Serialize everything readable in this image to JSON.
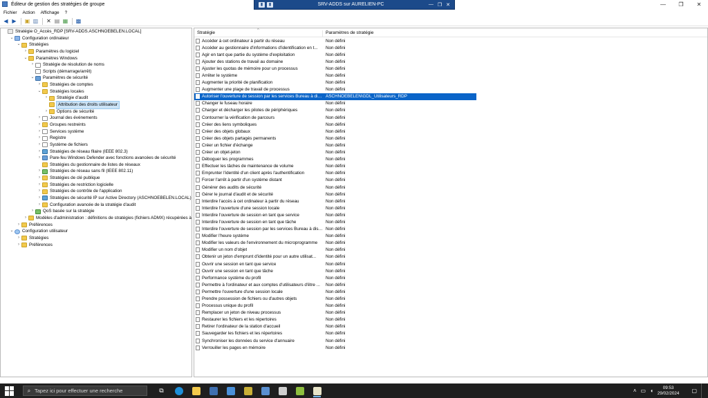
{
  "window": {
    "title": "Éditeur de gestion des stratégies de groupe",
    "controls": {
      "minimize": "—",
      "maximize": "❐",
      "close": "✕"
    }
  },
  "remote_bar": {
    "title": "SRV-ADDS sur AURELIEN-PC",
    "controls": {
      "minimize": "—",
      "restore": "❐",
      "close": "✕"
    }
  },
  "menu": {
    "items": [
      "Fichier",
      "Action",
      "Affichage",
      "?"
    ]
  },
  "tree": {
    "rows": [
      {
        "label": "Stratégie O_Accès_RDP [SRV-ADDS.ASCHNOEBELEN.LOCAL]",
        "indent": 0,
        "exp": "",
        "icon": "policy"
      },
      {
        "label": "Configuration ordinateur",
        "indent": 1,
        "exp": "⌄",
        "icon": "pc"
      },
      {
        "label": "Stratégies",
        "indent": 2,
        "exp": "⌄",
        "icon": "folder"
      },
      {
        "label": "Paramètres du logiciel",
        "indent": 3,
        "exp": "›",
        "icon": "folder"
      },
      {
        "label": "Paramètres Windows",
        "indent": 3,
        "exp": "⌄",
        "icon": "folder"
      },
      {
        "label": "Stratégie de résolution de noms",
        "indent": 4,
        "exp": "›",
        "icon": "doc"
      },
      {
        "label": "Scripts (démarrage/arrêt)",
        "indent": 4,
        "exp": "",
        "icon": "doc"
      },
      {
        "label": "Paramètres de sécurité",
        "indent": 4,
        "exp": "⌄",
        "icon": "shield"
      },
      {
        "label": "Stratégies de comptes",
        "indent": 5,
        "exp": "›",
        "icon": "folder"
      },
      {
        "label": "Stratégies locales",
        "indent": 5,
        "exp": "⌄",
        "icon": "folder"
      },
      {
        "label": "Stratégie d'audit",
        "indent": 6,
        "exp": "›",
        "icon": "folder"
      },
      {
        "label": "Attribution des droits utilisateur",
        "indent": 6,
        "exp": "",
        "icon": "folder",
        "selected": true
      },
      {
        "label": "Options de sécurité",
        "indent": 6,
        "exp": "›",
        "icon": "folder"
      },
      {
        "label": "Journal des événements",
        "indent": 5,
        "exp": "›",
        "icon": "doc"
      },
      {
        "label": "Groupes restreints",
        "indent": 5,
        "exp": "›",
        "icon": "folder"
      },
      {
        "label": "Services système",
        "indent": 5,
        "exp": "›",
        "icon": "doc"
      },
      {
        "label": "Registre",
        "indent": 5,
        "exp": "›",
        "icon": "doc"
      },
      {
        "label": "Système de fichiers",
        "indent": 5,
        "exp": "›",
        "icon": "doc"
      },
      {
        "label": "Stratégies de réseau filaire (IEEE 802.3)",
        "indent": 5,
        "exp": "›",
        "icon": "net"
      },
      {
        "label": "Pare-feu Windows Defender avec fonctions avancées de sécurité",
        "indent": 5,
        "exp": "›",
        "icon": "shield"
      },
      {
        "label": "Stratégies du gestionnaire de listes de réseaux",
        "indent": 5,
        "exp": "",
        "icon": "folder"
      },
      {
        "label": "Stratégies de réseau sans fil (IEEE 802.11)",
        "indent": 5,
        "exp": "›",
        "icon": "chart"
      },
      {
        "label": "Stratégies de clé publique",
        "indent": 5,
        "exp": "›",
        "icon": "folder"
      },
      {
        "label": "Stratégies de restriction logicielle",
        "indent": 5,
        "exp": "›",
        "icon": "folder"
      },
      {
        "label": "Stratégies de contrôle de l'application",
        "indent": 5,
        "exp": "›",
        "icon": "folder"
      },
      {
        "label": "Stratégies de sécurité IP sur Active Directory (ASCHNOEBELEN.LOCAL)",
        "indent": 5,
        "exp": "›",
        "icon": "net"
      },
      {
        "label": "Configuration avancée de la stratégie d'audit",
        "indent": 5,
        "exp": "›",
        "icon": "folder"
      },
      {
        "label": "QoS basée sur la stratégie",
        "indent": 4,
        "exp": "›",
        "icon": "chart"
      },
      {
        "label": "Modèles d'administration : définitions de stratégies (fichiers ADMX) récupérées à partir de l'ordinateur local.",
        "indent": 3,
        "exp": "›",
        "icon": "folder"
      },
      {
        "label": "Préférences",
        "indent": 2,
        "exp": "›",
        "icon": "folder"
      },
      {
        "label": "Configuration utilisateur",
        "indent": 1,
        "exp": "⌄",
        "icon": "user"
      },
      {
        "label": "Stratégies",
        "indent": 2,
        "exp": "›",
        "icon": "folder"
      },
      {
        "label": "Préférences",
        "indent": 2,
        "exp": "›",
        "icon": "folder"
      }
    ]
  },
  "list": {
    "columns": {
      "policy": "Stratégie",
      "setting": "Paramètres de stratégie"
    },
    "rows": [
      {
        "policy": "Accéder à cet ordinateur à partir du réseau",
        "setting": "Non défini"
      },
      {
        "policy": "Accéder au gestionnaire d'informations d'identification en t...",
        "setting": "Non défini"
      },
      {
        "policy": "Agir en tant que partie du système d'exploitation",
        "setting": "Non défini"
      },
      {
        "policy": "Ajouter des stations de travail au domaine",
        "setting": "Non défini"
      },
      {
        "policy": "Ajuster les quotas de mémoire pour un processus",
        "setting": "Non défini"
      },
      {
        "policy": "Arrêter le système",
        "setting": "Non défini"
      },
      {
        "policy": "Augmenter la priorité de planification",
        "setting": "Non défini"
      },
      {
        "policy": "Augmenter une plage de travail de processus",
        "setting": "Non défini"
      },
      {
        "policy": "Autoriser l'ouverture de session par les services Bureau à dist...",
        "setting": "ASCHNOEBELEN\\GDL_Utilisateurs_RDP",
        "selected": true
      },
      {
        "policy": "Changer le fuseau horaire",
        "setting": "Non défini"
      },
      {
        "policy": "Charger et décharger les pilotes de périphériques",
        "setting": "Non défini"
      },
      {
        "policy": "Contourner la vérification de parcours",
        "setting": "Non défini"
      },
      {
        "policy": "Créer des liens symboliques",
        "setting": "Non défini"
      },
      {
        "policy": "Créer des objets globaux",
        "setting": "Non défini"
      },
      {
        "policy": "Créer des objets partagés permanents",
        "setting": "Non défini"
      },
      {
        "policy": "Créer un fichier d'échange",
        "setting": "Non défini"
      },
      {
        "policy": "Créer un objet-jeton",
        "setting": "Non défini"
      },
      {
        "policy": "Déboguer les programmes",
        "setting": "Non défini"
      },
      {
        "policy": "Effectuer les tâches de maintenance de volume",
        "setting": "Non défini"
      },
      {
        "policy": "Emprunter l'identité d'un client après l'authentification",
        "setting": "Non défini"
      },
      {
        "policy": "Forcer l'arrêt à partir d'un système distant",
        "setting": "Non défini"
      },
      {
        "policy": "Générer des audits de sécurité",
        "setting": "Non défini"
      },
      {
        "policy": "Gérer le journal d'audit et de sécurité",
        "setting": "Non défini"
      },
      {
        "policy": "Interdire l'accès à cet ordinateur à partir du réseau",
        "setting": "Non défini"
      },
      {
        "policy": "Interdire l'ouverture d'une session locale",
        "setting": "Non défini"
      },
      {
        "policy": "Interdire l'ouverture de session en tant que service",
        "setting": "Non défini"
      },
      {
        "policy": "Interdire l'ouverture de session en tant que tâche",
        "setting": "Non défini"
      },
      {
        "policy": "Interdire l'ouverture de session par les services Bureau à dist...",
        "setting": "Non défini"
      },
      {
        "policy": "Modifier l'heure système",
        "setting": "Non défini"
      },
      {
        "policy": "Modifier les valeurs de l'environnement du microprogramme",
        "setting": "Non défini"
      },
      {
        "policy": "Modifier un nom d'objet",
        "setting": "Non défini"
      },
      {
        "policy": "Obtenir un jeton d'emprunt d'identité pour un autre utilisat...",
        "setting": "Non défini"
      },
      {
        "policy": "Ouvrir une session en tant que service",
        "setting": "Non défini"
      },
      {
        "policy": "Ouvrir une session en tant que tâche",
        "setting": "Non défini"
      },
      {
        "policy": "Performance système du profil",
        "setting": "Non défini"
      },
      {
        "policy": "Permettre à l'ordinateur et aux comptes d'utilisateurs d'être ...",
        "setting": "Non défini"
      },
      {
        "policy": "Permettre l'ouverture d'une session locale",
        "setting": "Non défini"
      },
      {
        "policy": "Prendre possession de fichiers ou d'autres objets",
        "setting": "Non défini"
      },
      {
        "policy": "Processus unique du profil",
        "setting": "Non défini"
      },
      {
        "policy": "Remplacer un jeton de niveau processus",
        "setting": "Non défini"
      },
      {
        "policy": "Restaurer les fichiers et les répertoires",
        "setting": "Non défini"
      },
      {
        "policy": "Retirer l'ordinateur de la station d'accueil",
        "setting": "Non défini"
      },
      {
        "policy": "Sauvegarder les fichiers et les répertoires",
        "setting": "Non défini"
      },
      {
        "policy": "Synchroniser les données du service d'annuaire",
        "setting": "Non défini"
      },
      {
        "policy": "Verrouiller les pages en mémoire",
        "setting": "Non défini"
      }
    ]
  },
  "taskbar": {
    "search_placeholder": "Tapez ici pour effectuer une recherche",
    "time": "09:53",
    "date": "29/02/2024",
    "accent": "#76b9ed",
    "apps": [
      {
        "name": "task-view",
        "glyph": "⧉",
        "color": "#ffffff"
      },
      {
        "name": "edge",
        "glyph": "",
        "color": "#1e8fd8"
      },
      {
        "name": "file-explorer",
        "glyph": "",
        "color": "#f2c94c"
      },
      {
        "name": "server-manager",
        "glyph": "",
        "color": "#3f6fb0"
      },
      {
        "name": "remote-desktop",
        "glyph": "",
        "color": "#4a90d9"
      },
      {
        "name": "installer",
        "glyph": "",
        "color": "#c9b037"
      },
      {
        "name": "network",
        "glyph": "",
        "color": "#5a8fd0"
      },
      {
        "name": "console",
        "glyph": "",
        "color": "#cfcfcf"
      },
      {
        "name": "app-green",
        "glyph": "",
        "color": "#8fbf3f"
      },
      {
        "name": "gpo-editor",
        "glyph": "",
        "color": "#e8e4c8",
        "active": true
      }
    ]
  }
}
